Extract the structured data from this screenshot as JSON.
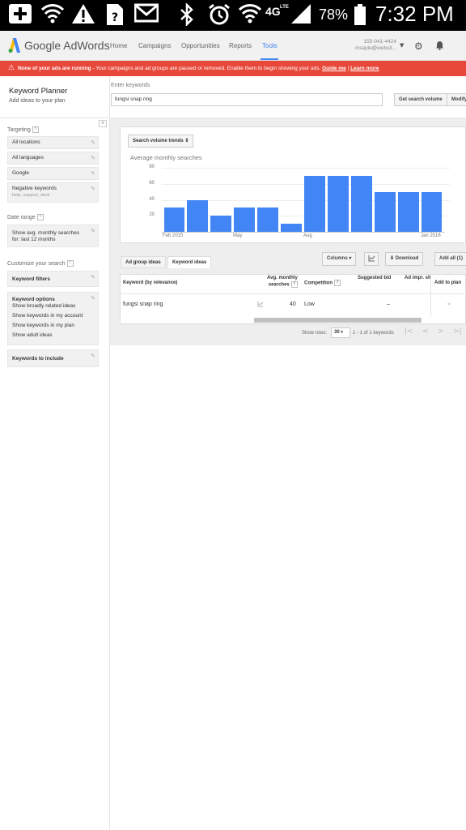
{
  "status_bar": {
    "battery": "78%",
    "time": "7:32 PM",
    "network": "4G",
    "network_sub": "LTE"
  },
  "header": {
    "brand": "Google AdWords",
    "nav": [
      "Home",
      "Campaigns",
      "Opportunities",
      "Reports",
      "Tools"
    ],
    "active_nav": "Tools",
    "account_id": "155-041-4424",
    "account_email": "msayle@websit..."
  },
  "alert": {
    "bold": "None of your ads are running",
    "text": " - Your campaigns and ad groups are paused or removed. Enable them to begin showing your ads. ",
    "guide": "Guide me",
    "sep": " | ",
    "learn": "Learn more"
  },
  "planner": {
    "title": "Keyword Planner",
    "subtitle": "Add ideas to your plan",
    "keywords_label": "Enter keywords",
    "keywords_value": "fungsi snap ring",
    "get_volume": "Get search volume",
    "modify": "Modify"
  },
  "sidebar": {
    "collapse": "«",
    "targeting_label": "Targeting",
    "targeting_items": [
      "All locations",
      "All languages",
      "Google"
    ],
    "negative_label": "Negative keywords",
    "negative_sub": "help, support, desk",
    "date_range_label": "Date range",
    "date_range_line1": "Show avg. monthly searches",
    "date_range_line2": "for: last 12 months",
    "customize_label": "Customize your search",
    "keyword_filters": "Keyword filters",
    "keyword_options": "Keyword options",
    "options": [
      "Show broadly related ideas",
      "Show keywords in my account",
      "Show keywords in my plan",
      "Show adult ideas"
    ],
    "keywords_to_include": "Keywords to include",
    "help": "?"
  },
  "chart_card": {
    "dropdown": "Search volume trends"
  },
  "chart_data": {
    "type": "bar",
    "title": "Average monthly searches",
    "categories": [
      "Feb 2015",
      "Mar 2015",
      "Apr 2015",
      "May 2015",
      "Jun 2015",
      "Jul 2015",
      "Aug 2015",
      "Sep 2015",
      "Oct 2015",
      "Nov 2015",
      "Dec 2015",
      "Jan 2016"
    ],
    "values": [
      30,
      40,
      20,
      30,
      30,
      10,
      70,
      70,
      70,
      50,
      50,
      50
    ],
    "yticks": [
      20,
      40,
      60,
      80
    ],
    "xtick_labels": [
      {
        "index": 0,
        "label": "Feb 2015"
      },
      {
        "index": 3,
        "label": "May"
      },
      {
        "index": 6,
        "label": "Aug"
      },
      {
        "index": 11,
        "label": "Jan 2016"
      }
    ],
    "ylim": [
      0,
      80
    ],
    "color": "#4285f4",
    "grid": true
  },
  "tabs": {
    "ad_group_ideas": "Ad group ideas",
    "keyword_ideas": "Keyword ideas",
    "active": "Keyword ideas"
  },
  "toolbar": {
    "columns": "Columns",
    "download": "Download",
    "add_all": "Add all (1)"
  },
  "table": {
    "headers": {
      "keyword": "Keyword (by relevance)",
      "avg1": "Avg. monthly",
      "avg2": "searches",
      "competition": "Competition",
      "bid": "Suggested bid",
      "impr": "Ad impr. sh",
      "add": "Add to plan"
    },
    "rows": [
      {
        "keyword": "fungsi snap ring",
        "searches": "40",
        "competition": "Low",
        "bid": "–",
        "add": "»"
      }
    ]
  },
  "footer": {
    "show_rows_label": "Show rows:",
    "rows_value": "30",
    "range": "1 - 1 of 1 keywords"
  }
}
